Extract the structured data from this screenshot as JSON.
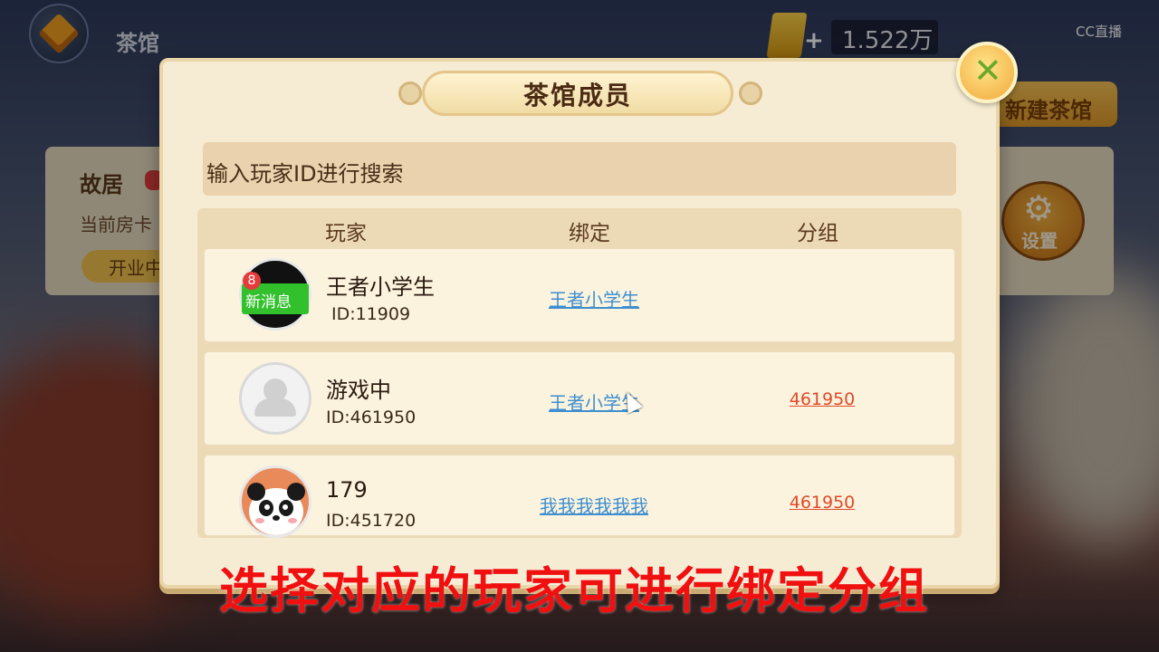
{
  "header": {
    "title": "茶馆",
    "gold_amount": "1.522万",
    "gold_plus": "+",
    "stream_logo": "CC直播"
  },
  "background": {
    "card_title": "故居",
    "card_subtitle": "当前房卡",
    "open_button": "开业中",
    "new_house_button": "新建茶馆",
    "settings_button": "设置"
  },
  "dialog": {
    "title": "茶馆成员",
    "search_placeholder": "输入玩家ID进行搜索",
    "columns": [
      "玩家",
      "绑定",
      "分组"
    ],
    "rows": [
      {
        "name": "王者小学生",
        "id": "ID:11909",
        "bind": "王者小学生",
        "group": "",
        "avatar": "new-message",
        "msg_count": "8",
        "msg_label": "新消息"
      },
      {
        "name": "游戏中",
        "id": "ID:461950",
        "bind": "王者小学生",
        "group": "461950",
        "avatar": "default"
      },
      {
        "name": "179",
        "id": "ID:451720",
        "bind": "我我我我我我",
        "group": "461950",
        "avatar": "panda"
      }
    ]
  },
  "caption": "选择对应的玩家可进行绑定分组",
  "colors": {
    "dialog_bg": "#f6ecd3",
    "link_blue": "#3d8fd0",
    "group_red": "#e04a2a",
    "caption_red": "#f01010",
    "new_msg_green": "#32c02c"
  }
}
